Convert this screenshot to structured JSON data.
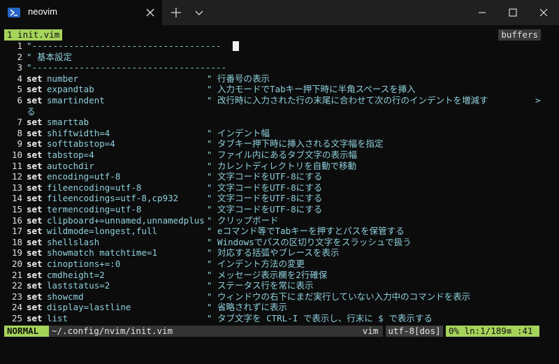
{
  "window": {
    "tab_title": "neovim",
    "icons": {
      "tab": "terminal-prompt-icon",
      "close_tab": "close-icon",
      "new_tab": "plus-icon",
      "dropdown": "chevron-down-icon",
      "minimize": "minimize-icon",
      "maximize": "maximize-icon",
      "close_window": "close-icon"
    }
  },
  "tabline": {
    "active": "1 init.vim",
    "buffers": "buffers"
  },
  "editor": {
    "lines": [
      {
        "n": "1",
        "full": "\"------------------------------------"
      },
      {
        "n": "2",
        "full": "\" 基本設定"
      },
      {
        "n": "3",
        "full": "\"-------------------------------------"
      },
      {
        "n": "4",
        "kw": "set",
        "opt": "number",
        "cmt": "\" 行番号の表示"
      },
      {
        "n": "5",
        "kw": "set",
        "opt": "expandtab",
        "cmt": "\" 入力モードでTabキー押下時に半角スペースを挿入"
      },
      {
        "n": "6",
        "kw": "set",
        "opt": "smartindent",
        "cmt": "\" 改行時に入力された行の末尾に合わせて次の行のインデントを増減す",
        "arrow": ">"
      },
      {
        "n": "",
        "full": "る"
      },
      {
        "n": "7",
        "kw": "set",
        "opt": "smarttab"
      },
      {
        "n": "8",
        "kw": "set",
        "opt": "shiftwidth=4",
        "cmt": "\" インデント幅"
      },
      {
        "n": "9",
        "kw": "set",
        "opt": "softtabstop=4",
        "cmt": "\" タブキー押下時に挿入される文字幅を指定"
      },
      {
        "n": "10",
        "kw": "set",
        "opt": "tabstop=4",
        "cmt": "\" ファイル内にあるタブ文字の表示幅"
      },
      {
        "n": "11",
        "kw": "set",
        "opt": "autochdir",
        "cmt": "\" カレントディレクトリを自動で移動"
      },
      {
        "n": "12",
        "kw": "set",
        "opt": "encoding=utf-8",
        "cmt": "\" 文字コードをUTF-8にする"
      },
      {
        "n": "13",
        "kw": "set",
        "opt": "fileencoding=utf-8",
        "cmt": "\" 文字コードをUTF-8にする"
      },
      {
        "n": "14",
        "kw": "set",
        "opt": "fileencodings=utf-8,cp932",
        "cmt": "\" 文字コードをUTF-8にする"
      },
      {
        "n": "15",
        "kw": "set",
        "opt": "termencoding=utf-8",
        "cmt": "\" 文字コードをUTF-8にする"
      },
      {
        "n": "16",
        "kw": "set",
        "opt": "clipboard+=unnamed,unnamedplus",
        "cmt": "\" クリップボード"
      },
      {
        "n": "17",
        "kw": "set",
        "opt": "wildmode=longest,full",
        "cmt": "\" eコマンド等でTabキーを押すとパスを保管する"
      },
      {
        "n": "18",
        "kw": "set",
        "opt": "shellslash",
        "cmt": "\" Windowsでパスの区切り文字をスラッシュで扱う"
      },
      {
        "n": "19",
        "kw": "set",
        "opt": "showmatch matchtime=1",
        "cmt": "\" 対応する括弧やブレースを表示"
      },
      {
        "n": "20",
        "kw": "set",
        "opt": "cinoptions+=:0",
        "cmt": "\" インデント方法の変更"
      },
      {
        "n": "21",
        "kw": "set",
        "opt": "cmdheight=2",
        "cmt": "\" メッセージ表示欄を2行確保"
      },
      {
        "n": "22",
        "kw": "set",
        "opt": "laststatus=2",
        "cmt": "\" ステータス行を常に表示"
      },
      {
        "n": "23",
        "kw": "set",
        "opt": "showcmd",
        "cmt": "\" ウィンドウの右下にまだ実行していない入力中のコマンドを表示"
      },
      {
        "n": "24",
        "kw": "set",
        "opt": "display=lastline",
        "cmt": "\" 省略されずに表示"
      },
      {
        "n": "25",
        "kw": "set",
        "opt": "list",
        "cmt": "\" タブ文字を CTRL-I で表示し、行末に $ で表示する"
      }
    ]
  },
  "statusline": {
    "mode": "NORMAL",
    "file": "~/.config/nvim/init.vim",
    "filetype": "vim",
    "encoding": "utf-8[dos]",
    "position": "0% ln:1/189≡ :41"
  }
}
